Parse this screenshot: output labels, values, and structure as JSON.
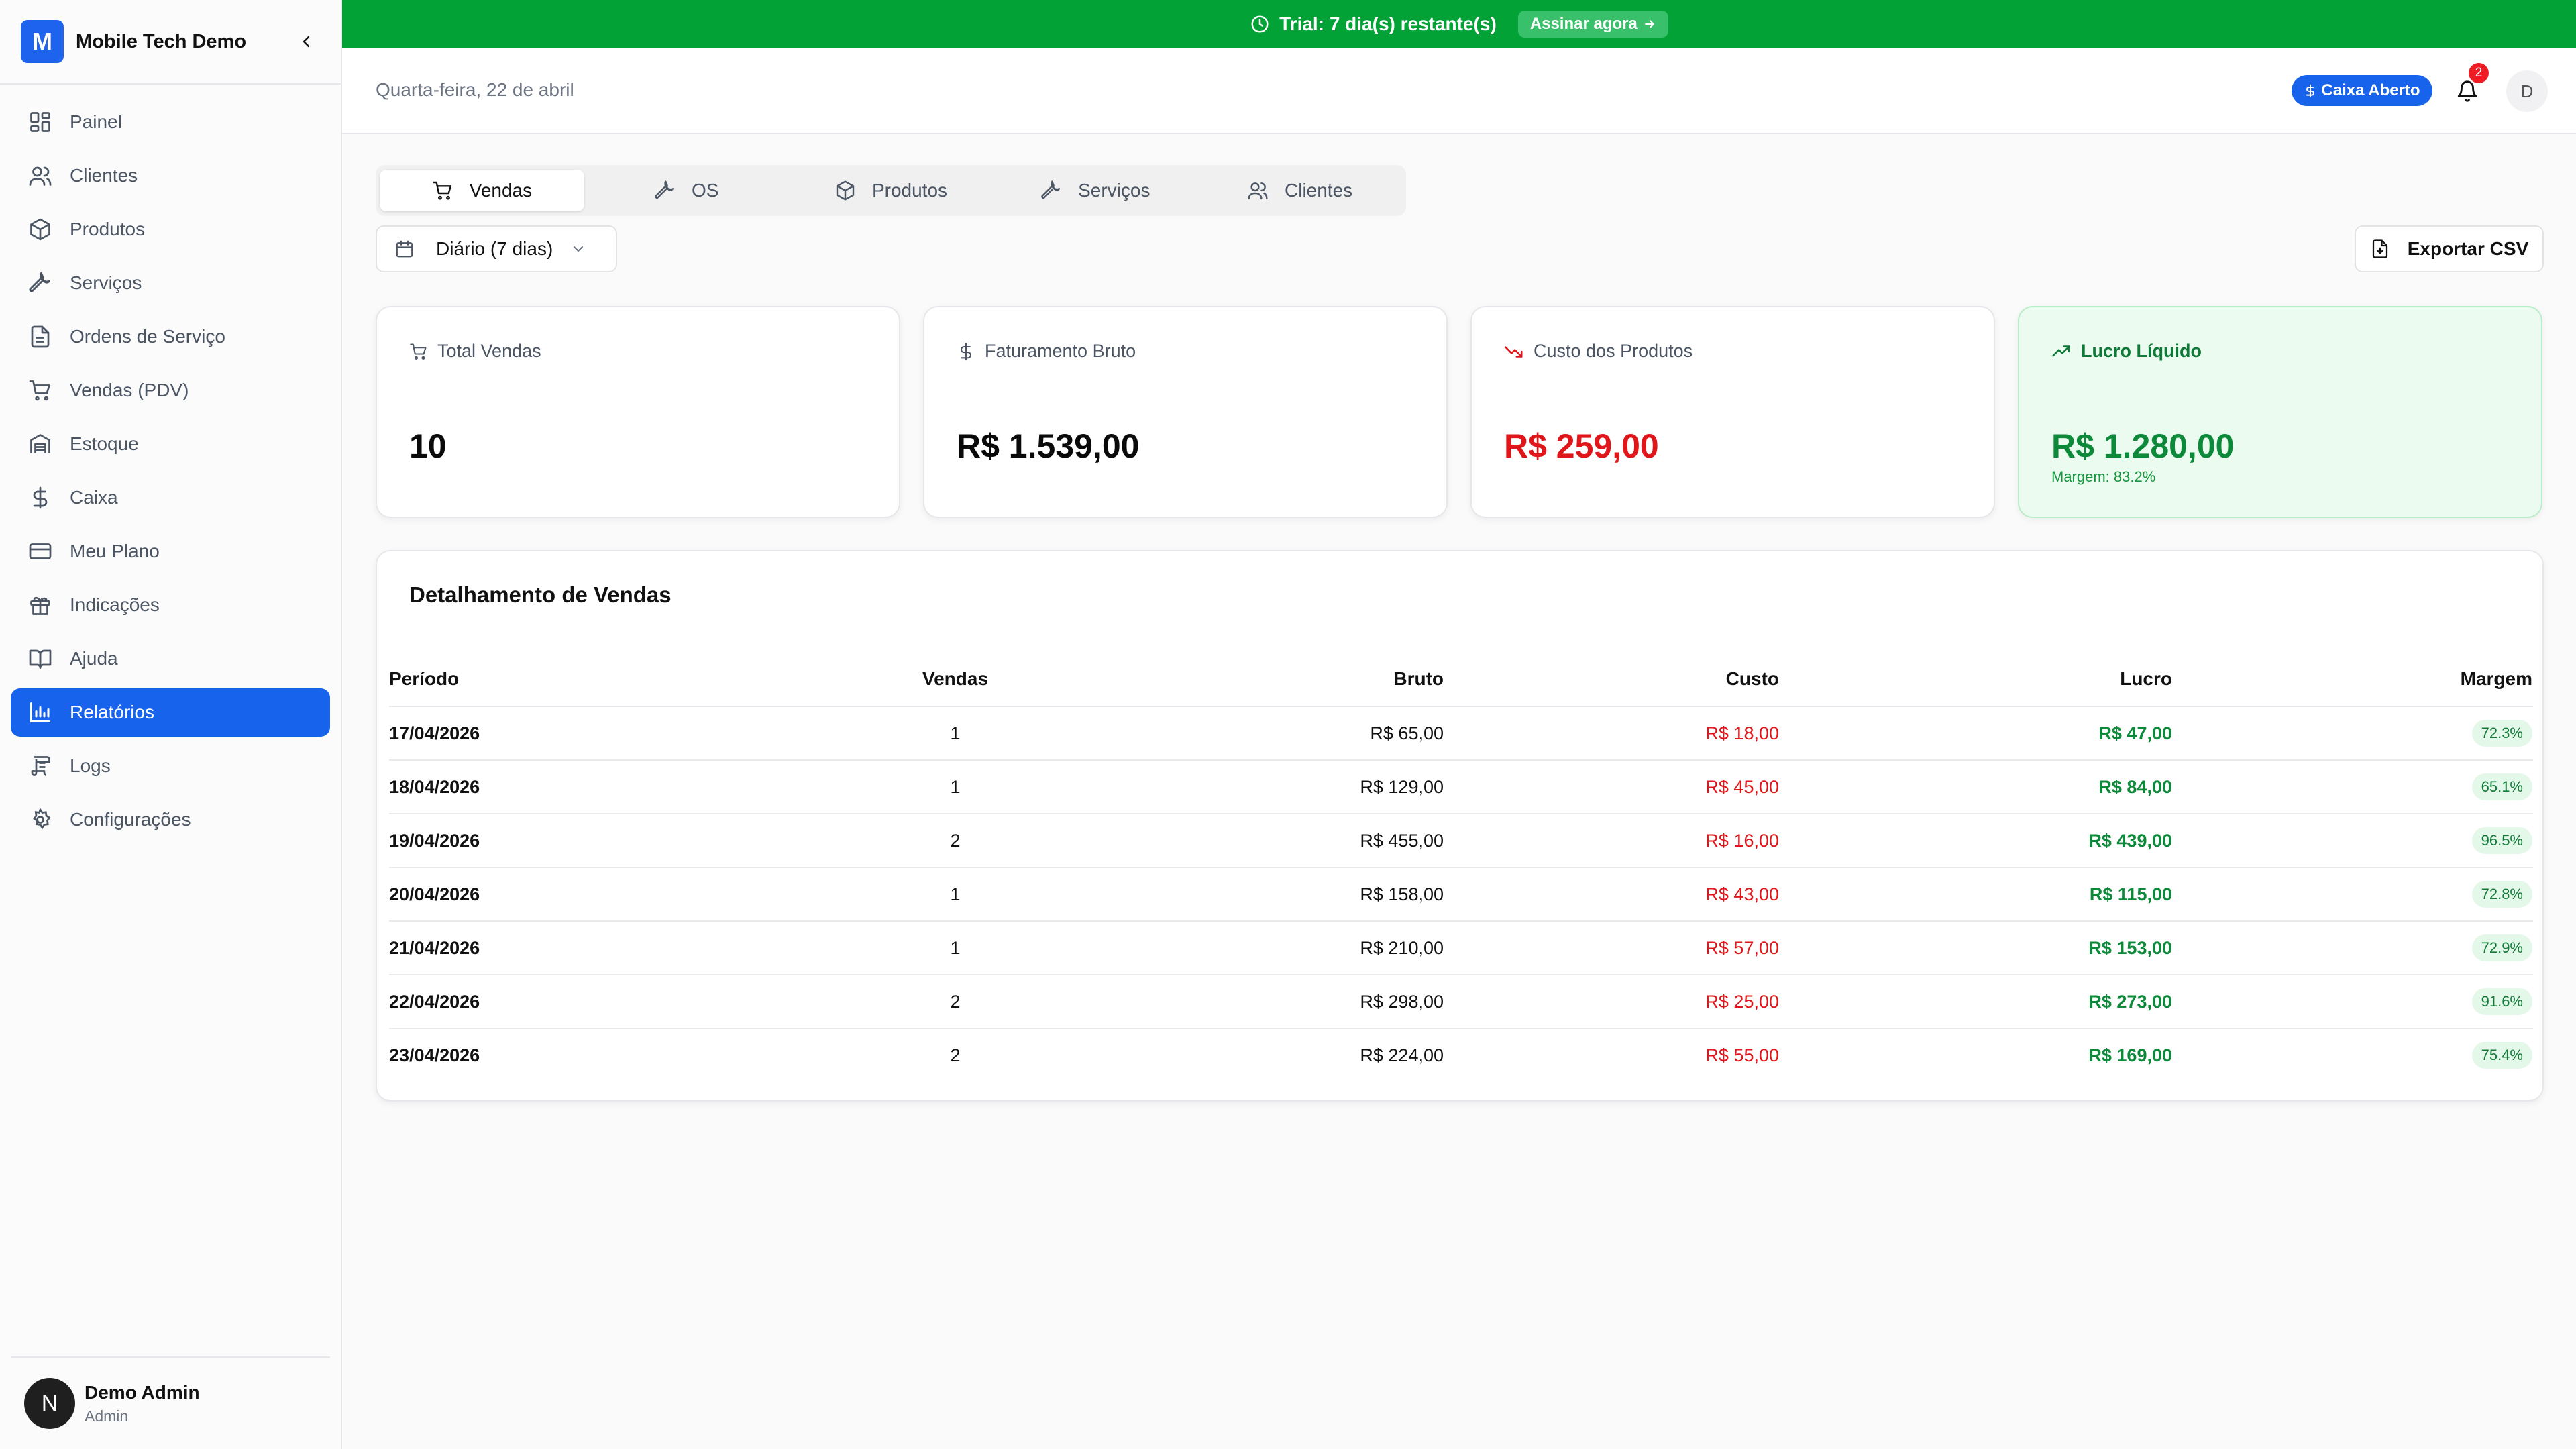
{
  "sidebar": {
    "logo_letter": "M",
    "brand": "Mobile Tech Demo",
    "items": [
      {
        "label": "Painel",
        "icon": "dashboard-grid-icon"
      },
      {
        "label": "Clientes",
        "icon": "users-icon"
      },
      {
        "label": "Produtos",
        "icon": "package-icon"
      },
      {
        "label": "Serviços",
        "icon": "wrench-icon"
      },
      {
        "label": "Ordens de Serviço",
        "icon": "document-icon"
      },
      {
        "label": "Vendas (PDV)",
        "icon": "shopping-cart-icon"
      },
      {
        "label": "Estoque",
        "icon": "warehouse-icon"
      },
      {
        "label": "Caixa",
        "icon": "dollar-icon"
      },
      {
        "label": "Meu Plano",
        "icon": "credit-card-icon"
      },
      {
        "label": "Indicações",
        "icon": "gift-icon"
      },
      {
        "label": "Ajuda",
        "icon": "book-icon"
      },
      {
        "label": "Relatórios",
        "icon": "bar-chart-icon",
        "active": true
      },
      {
        "label": "Logs",
        "icon": "scroll-icon"
      },
      {
        "label": "Configurações",
        "icon": "gear-icon"
      }
    ],
    "user": {
      "initial": "N",
      "name": "Demo Admin",
      "role": "Admin"
    }
  },
  "banner": {
    "text": "Trial: 7 dia(s) restante(s)",
    "cta": "Assinar agora",
    "color": "#02a237"
  },
  "header": {
    "date": "Quarta-feira, 22 de abril",
    "caixa_status": "Caixa Aberto",
    "notification_count": "2",
    "user_initial": "D"
  },
  "tabs": [
    {
      "label": "Vendas",
      "icon": "shopping-cart-icon",
      "active": true
    },
    {
      "label": "OS",
      "icon": "wrench-icon"
    },
    {
      "label": "Produtos",
      "icon": "package-icon"
    },
    {
      "label": "Serviços",
      "icon": "wrench-icon"
    },
    {
      "label": "Clientes",
      "icon": "users-icon"
    }
  ],
  "filter": {
    "period": "Diário (7 dias)"
  },
  "export_label": "Exportar CSV",
  "cards": {
    "total_vendas": {
      "label": "Total Vendas",
      "value": "10"
    },
    "faturamento": {
      "label": "Faturamento Bruto",
      "value": "R$ 1.539,00"
    },
    "custo": {
      "label": "Custo dos Produtos",
      "value": "R$ 259,00"
    },
    "lucro": {
      "label": "Lucro Líquido",
      "value": "R$ 1.280,00",
      "sub": "Margem: 83.2%"
    }
  },
  "table": {
    "title": "Detalhamento de Vendas",
    "headers": {
      "periodo": "Período",
      "vendas": "Vendas",
      "bruto": "Bruto",
      "custo": "Custo",
      "lucro": "Lucro",
      "margem": "Margem"
    },
    "rows": [
      {
        "periodo": "17/04/2026",
        "vendas": "1",
        "bruto": "R$ 65,00",
        "custo": "R$ 18,00",
        "lucro": "R$ 47,00",
        "margem": "72.3%"
      },
      {
        "periodo": "18/04/2026",
        "vendas": "1",
        "bruto": "R$ 129,00",
        "custo": "R$ 45,00",
        "lucro": "R$ 84,00",
        "margem": "65.1%"
      },
      {
        "periodo": "19/04/2026",
        "vendas": "2",
        "bruto": "R$ 455,00",
        "custo": "R$ 16,00",
        "lucro": "R$ 439,00",
        "margem": "96.5%"
      },
      {
        "periodo": "20/04/2026",
        "vendas": "1",
        "bruto": "R$ 158,00",
        "custo": "R$ 43,00",
        "lucro": "R$ 115,00",
        "margem": "72.8%"
      },
      {
        "periodo": "21/04/2026",
        "vendas": "1",
        "bruto": "R$ 210,00",
        "custo": "R$ 57,00",
        "lucro": "R$ 153,00",
        "margem": "72.9%"
      },
      {
        "periodo": "22/04/2026",
        "vendas": "2",
        "bruto": "R$ 298,00",
        "custo": "R$ 25,00",
        "lucro": "R$ 273,00",
        "margem": "91.6%"
      },
      {
        "periodo": "23/04/2026",
        "vendas": "2",
        "bruto": "R$ 224,00",
        "custo": "R$ 55,00",
        "lucro": "R$ 169,00",
        "margem": "75.4%"
      }
    ]
  },
  "colors": {
    "primary": "#1763ec",
    "success": "#0c8a3a",
    "danger": "#e0161b",
    "banner": "#02a237"
  }
}
